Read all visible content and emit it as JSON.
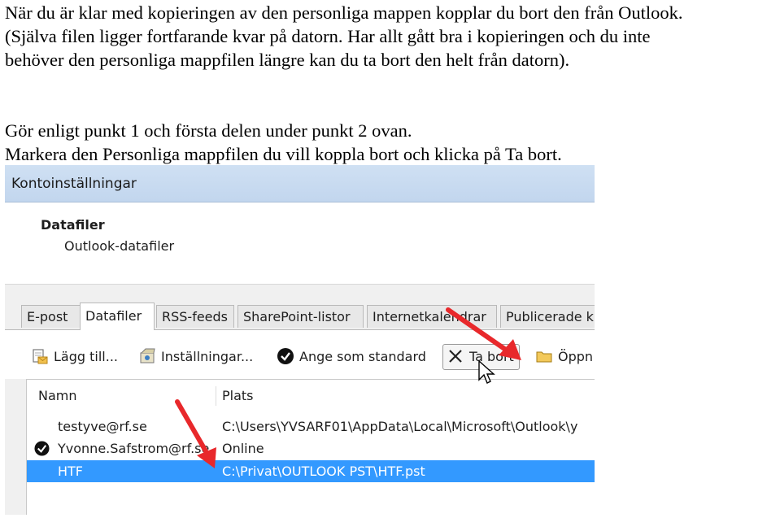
{
  "text": {
    "para1_lines": [
      "När du är klar med kopieringen av den personliga mappen kopplar du bort den från Outlook.",
      "(Själva filen ligger fortfarande kvar på datorn. Har allt gått bra i kopieringen och du inte",
      "behöver den personliga mappfilen längre kan du ta bort den helt från datorn)."
    ],
    "para2_lines": [
      "Gör enligt punkt 1 och första delen under punkt 2 ovan.",
      "Markera den Personliga mappfilen du vill koppla bort och klicka på Ta bort."
    ]
  },
  "dialog": {
    "title": "Kontoinställningar",
    "section_title": "Datafiler",
    "section_subtitle": "Outlook-datafiler",
    "tabs": [
      "E-post",
      "Datafiler",
      "RSS-feeds",
      "SharePoint-listor",
      "Internetkalendrar",
      "Publicerade k"
    ],
    "active_tab": "Datafiler",
    "toolbar": {
      "add": "Lägg till...",
      "settings": "Inställningar...",
      "set_default": "Ange som standard",
      "remove": "Ta bort",
      "open": "Öppn"
    },
    "columns": {
      "name": "Namn",
      "location": "Plats"
    },
    "rows": [
      {
        "name": "testyve@rf.se",
        "location": "C:\\Users\\YVSARF01\\AppData\\Local\\Microsoft\\Outlook\\y",
        "default": false,
        "selected": false
      },
      {
        "name": "Yvonne.Safstrom@rf.se",
        "location": "Online",
        "default": true,
        "selected": false
      },
      {
        "name": "HTF",
        "location": "C:\\Privat\\OUTLOOK PST\\HTF.pst",
        "default": false,
        "selected": true
      }
    ]
  },
  "colors": {
    "selection": "#3399ff",
    "arrow": "#e8282b",
    "title_bar": "#c8dbf1"
  }
}
